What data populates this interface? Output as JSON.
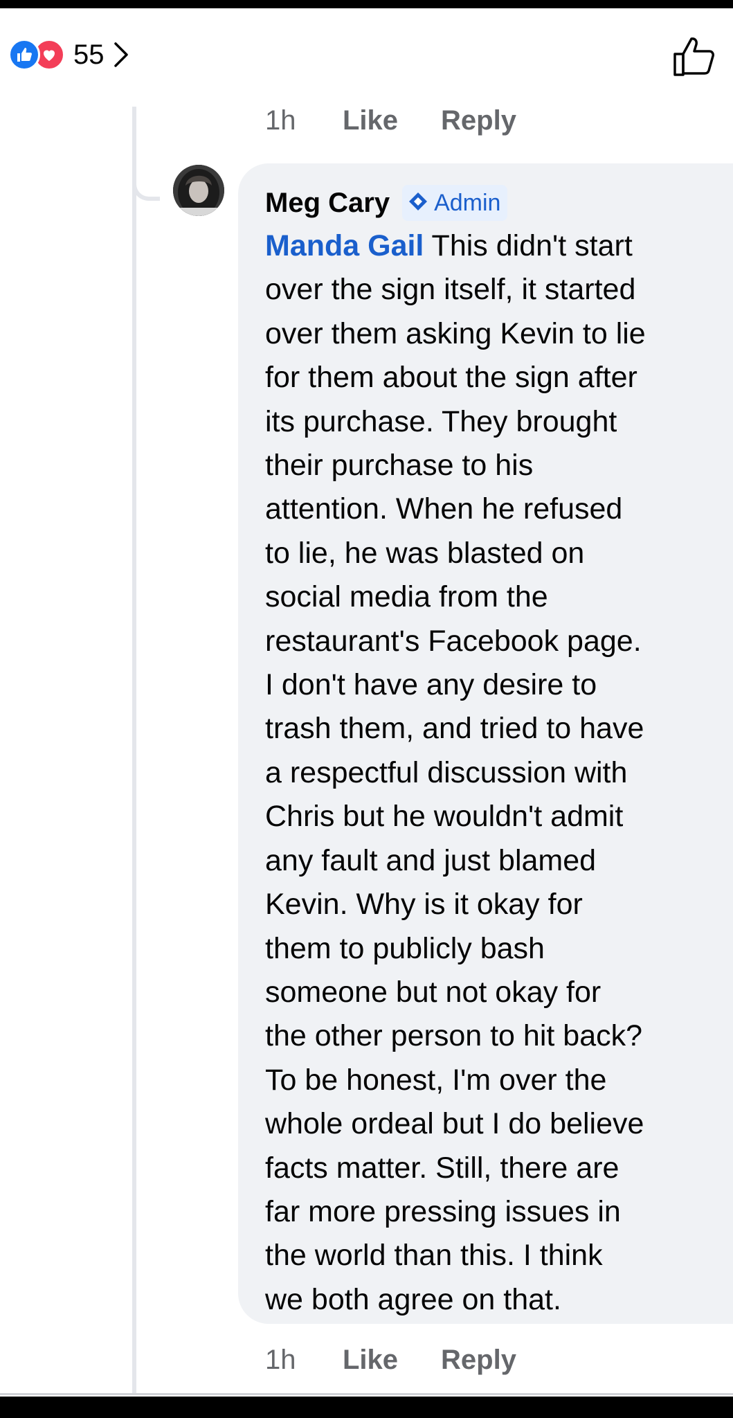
{
  "reactions": {
    "count": "55",
    "icons": [
      "like-icon",
      "love-icon"
    ],
    "like_color": "#1877f2",
    "love_color": "#f33e58"
  },
  "thread": {
    "top_actions": {
      "time": "1h",
      "like": "Like",
      "reply": "Reply"
    },
    "comment": {
      "author": "Meg Cary",
      "badge": "Admin",
      "mention": "Manda Gail",
      "lines": [
        " This didn't start",
        "over the sign itself, it started",
        "over them asking Kevin to lie",
        "for them about the sign after",
        "its purchase. They brought",
        "their purchase to his",
        "attention. When he refused",
        "to lie, he was blasted on",
        "social media from the",
        "restaurant's Facebook page.",
        "I don't have any desire to",
        "trash them, and tried to have",
        "a respectful discussion with",
        "Chris but he wouldn't admit",
        "any fault and just blamed",
        "Kevin. Why is it okay for",
        "them to publicly bash",
        "someone but not okay for",
        "the other person to hit back?",
        "To be honest, I'm over the",
        "whole ordeal but I do believe",
        "facts matter. Still, there are",
        "far more pressing issues in",
        "the world than this. I think",
        "we both agree on that."
      ]
    },
    "bottom_actions": {
      "time": "1h",
      "like": "Like",
      "reply": "Reply"
    }
  },
  "colors": {
    "accent": "#1877f2",
    "mention": "#1a5fcc",
    "muted_text": "#65676b",
    "bubble_bg": "#f0f2f5"
  }
}
